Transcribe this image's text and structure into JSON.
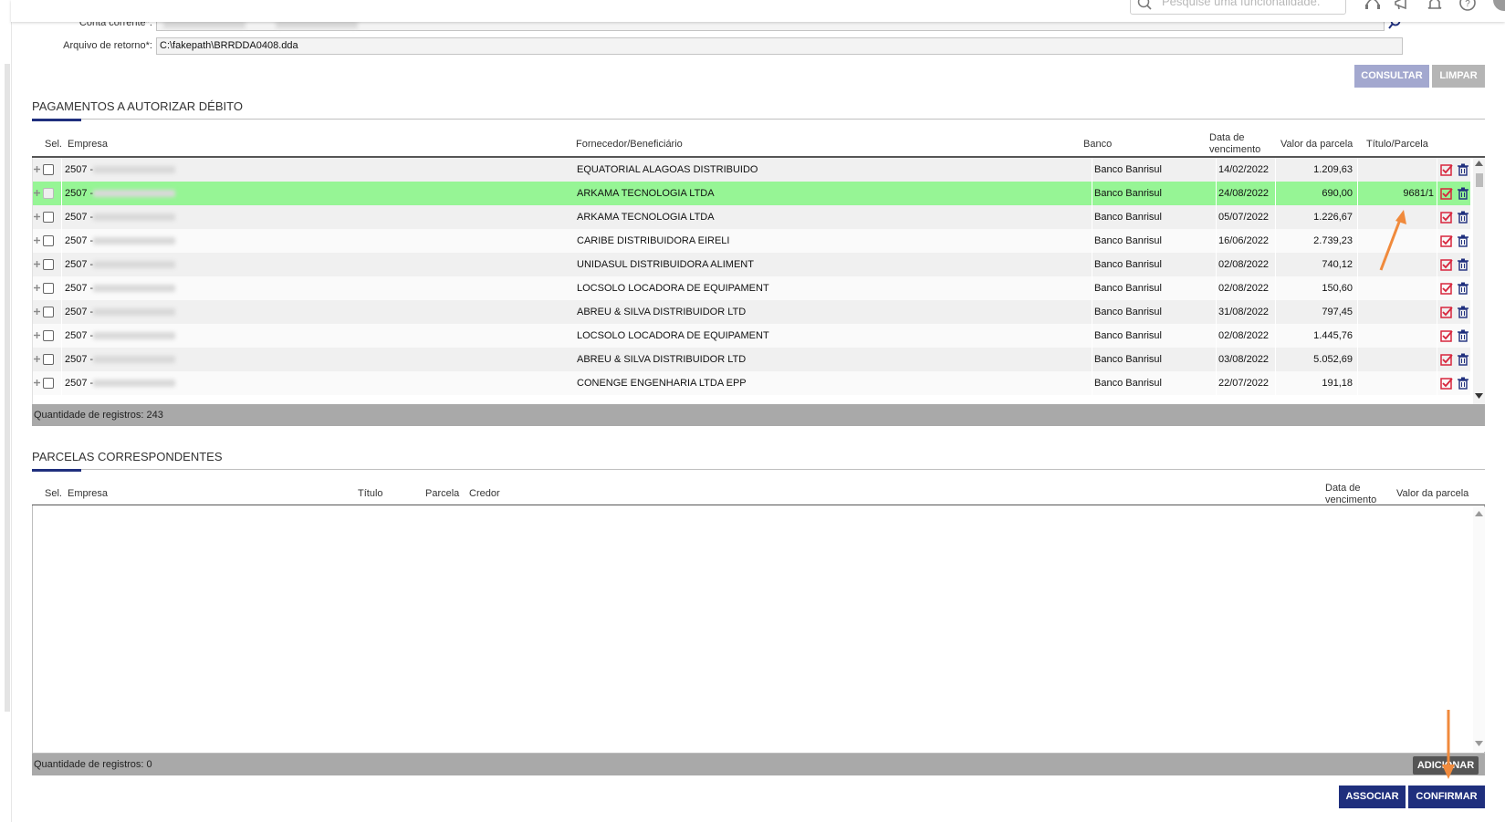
{
  "top": {
    "search_placeholder": "Pesquise uma funcionalidade."
  },
  "form": {
    "conta_label": "Conta corrente*:",
    "arquivo_label": "Arquivo de retorno*:",
    "arquivo_value": "C:\\fakepath\\BRRDDA0408.dda"
  },
  "buttons": {
    "consultar": "CONSULTAR",
    "limpar": "LIMPAR",
    "adicionar": "ADICIONAR",
    "associar": "ASSOCIAR",
    "confirmar": "CONFIRMAR"
  },
  "pagamentos": {
    "title": "PAGAMENTOS A AUTORIZAR DÉBITO",
    "headers": {
      "sel": "Sel.",
      "empresa": "Empresa",
      "fornecedor": "Fornecedor/Beneficiário",
      "banco": "Banco",
      "vencimento_1": "Data de",
      "vencimento_2": "vencimento",
      "valor": "Valor da parcela",
      "titulo": "Título/Parcela"
    },
    "rows": [
      {
        "empresa": "2507 -",
        "fornecedor": "EQUATORIAL ALAGOAS DISTRIBUIDO",
        "banco": "Banco Banrisul",
        "vencimento": "14/02/2022",
        "valor": "1.209,63",
        "titulo": ""
      },
      {
        "empresa": "2507 -",
        "fornecedor": "ARKAMA TECNOLOGIA LTDA",
        "banco": "Banco Banrisul",
        "vencimento": "24/08/2022",
        "valor": "690,00",
        "titulo": "9681/1"
      },
      {
        "empresa": "2507 -",
        "fornecedor": "ARKAMA TECNOLOGIA LTDA",
        "banco": "Banco Banrisul",
        "vencimento": "05/07/2022",
        "valor": "1.226,67",
        "titulo": ""
      },
      {
        "empresa": "2507 -",
        "fornecedor": "CARIBE DISTRIBUIDORA EIRELI",
        "banco": "Banco Banrisul",
        "vencimento": "16/06/2022",
        "valor": "2.739,23",
        "titulo": ""
      },
      {
        "empresa": "2507 -",
        "fornecedor": "UNIDASUL DISTRIBUIDORA ALIMENT",
        "banco": "Banco Banrisul",
        "vencimento": "02/08/2022",
        "valor": "740,12",
        "titulo": ""
      },
      {
        "empresa": "2507 -",
        "fornecedor": "LOCSOLO LOCADORA DE EQUIPAMENT",
        "banco": "Banco Banrisul",
        "vencimento": "02/08/2022",
        "valor": "150,60",
        "titulo": ""
      },
      {
        "empresa": "2507 -",
        "fornecedor": "ABREU & SILVA DISTRIBUIDOR LTD",
        "banco": "Banco Banrisul",
        "vencimento": "31/08/2022",
        "valor": "797,45",
        "titulo": ""
      },
      {
        "empresa": "2507 -",
        "fornecedor": "LOCSOLO LOCADORA DE EQUIPAMENT",
        "banco": "Banco Banrisul",
        "vencimento": "02/08/2022",
        "valor": "1.445,76",
        "titulo": ""
      },
      {
        "empresa": "2507 -",
        "fornecedor": "ABREU & SILVA DISTRIBUIDOR LTD",
        "banco": "Banco Banrisul",
        "vencimento": "03/08/2022",
        "valor": "5.052,69",
        "titulo": ""
      },
      {
        "empresa": "2507 -",
        "fornecedor": "CONENGE ENGENHARIA LTDA   EPP",
        "banco": "Banco Banrisul",
        "vencimento": "22/07/2022",
        "valor": "191,18",
        "titulo": ""
      }
    ],
    "selected_row": 1,
    "footer": "Quantidade de registros: 243"
  },
  "parcelas": {
    "title": "PARCELAS CORRESPONDENTES",
    "headers": {
      "sel": "Sel.",
      "empresa": "Empresa",
      "titulo": "Título",
      "parcela": "Parcela",
      "credor": "Credor",
      "vencimento_1": "Data de",
      "vencimento_2": "vencimento",
      "valor": "Valor da parcela"
    },
    "footer": "Quantidade de registros: 0"
  },
  "colors": {
    "selected_row": "#96f595",
    "navy": "#1f2f7d",
    "annotation_arrow": "#f08a3c",
    "consultar": "#a3a8cf"
  }
}
